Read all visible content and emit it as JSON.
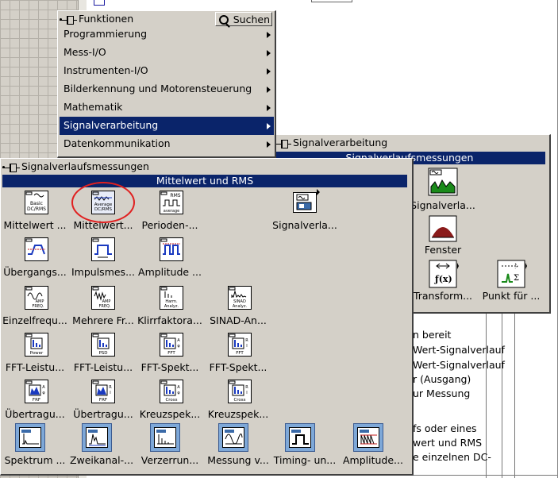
{
  "functions_menu": {
    "title": "Funktionen",
    "search_label": "Suchen",
    "items": [
      {
        "label": "Programmierung"
      },
      {
        "label": "Mess-I/O"
      },
      {
        "label": "Instrumenten-I/O"
      },
      {
        "label": "Bilderkennung und Motorensteuerung"
      },
      {
        "label": "Mathematik"
      },
      {
        "label": "Signalverarbeitung"
      },
      {
        "label": "Datenkommunikation"
      }
    ],
    "selected_index": 5
  },
  "signal_processing_palette": {
    "title": "Signalverarbeitung",
    "header": "Signalverlaufsmessungen",
    "items": [
      {
        "label": "Signalverla...",
        "icon": "signal-generation-icon"
      },
      {
        "label": "Fenster",
        "icon": "window-icon"
      },
      {
        "label": "Transform...",
        "icon": "transform-icon"
      },
      {
        "label": "Punkt für ...",
        "icon": "point-by-point-icon"
      }
    ]
  },
  "measurement_palette": {
    "title": "Signalverlaufsmessungen",
    "header": "Mittelwert und RMS",
    "rows": [
      [
        {
          "label": "Mittelwert ...",
          "caption": "Basic\nDC/RMS",
          "icon": "basic-dc-rms-icon"
        },
        {
          "label": "Mittelwert...",
          "caption": "Average\nDC/RMS",
          "icon": "average-dc-rms-icon"
        },
        {
          "label": "Perioden-...",
          "caption": "RMS\naverage",
          "icon": "periodic-average-icon"
        },
        {
          "label": "Signalverla...",
          "caption": "",
          "icon": "waveform-subpalette-icon"
        }
      ],
      [
        {
          "label": "Übergangs...",
          "caption": "",
          "icon": "transition-measurement-icon"
        },
        {
          "label": "Impulsmes...",
          "caption": "",
          "icon": "pulse-measurement-icon"
        },
        {
          "label": "Amplitude ...",
          "caption": "",
          "icon": "amplitude-level-icon"
        }
      ],
      [
        {
          "label": "Einzelfrequ...",
          "caption": "AMP\nFREQ.",
          "icon": "single-tone-icon"
        },
        {
          "label": "Mehrere Fr...",
          "caption": "AMP\nFREQ.",
          "icon": "multi-tone-icon"
        },
        {
          "label": "Klirrfaktora...",
          "caption": "Harm.\nAnalyz.",
          "icon": "harmonic-distortion-icon"
        },
        {
          "label": "SINAD-An...",
          "caption": "SINAD\nAnalyz.",
          "icon": "sinad-icon"
        }
      ],
      [
        {
          "label": "FFT-Leistu...",
          "caption": "Power",
          "icon": "fft-power-icon"
        },
        {
          "label": "FFT-Leistu...",
          "caption": "PSD",
          "icon": "fft-psd-icon"
        },
        {
          "label": "FFT-Spekt...",
          "caption": "FFT",
          "icon": "fft-spectrum-mag-icon"
        },
        {
          "label": "FFT-Spekt...",
          "caption": "FFT",
          "icon": "fft-spectrum-ri-icon"
        }
      ],
      [
        {
          "label": "Übertragu...",
          "caption": "FRF",
          "icon": "frf-mag-icon"
        },
        {
          "label": "Übertragu...",
          "caption": "FRF",
          "icon": "frf-ri-icon"
        },
        {
          "label": "Kreuzspek...",
          "caption": "Cross",
          "icon": "cross-spectrum-mag-icon"
        },
        {
          "label": "Kreuzspek...",
          "caption": "Cross",
          "icon": "cross-spectrum-ri-icon"
        }
      ],
      [
        {
          "label": "Spektrum ...",
          "icon": "spectral-measurements-express-icon"
        },
        {
          "label": "Zweikanal-...",
          "icon": "dual-channel-express-icon"
        },
        {
          "label": "Verzerrun...",
          "icon": "distortion-express-icon"
        },
        {
          "label": "Messung v...",
          "icon": "tone-measurement-express-icon"
        },
        {
          "label": "Timing- un...",
          "icon": "timing-transition-express-icon"
        },
        {
          "label": "Amplitude...",
          "icon": "amplitude-level-express-icon"
        }
      ]
    ]
  },
  "background_help": {
    "lines": [
      "n bereit",
      "Wert-Signalverlauf",
      "Wert-Signalverlauf",
      "r (Ausgang)",
      "ur Messung",
      "fs oder eines",
      "wert und RMS",
      "e einzelnen DC-"
    ]
  },
  "colors": {
    "selection": "#0a246a",
    "palette_bg": "#d4d0c8",
    "highlight_circle": "#e02020",
    "express_tile": "#7ea8d8"
  }
}
